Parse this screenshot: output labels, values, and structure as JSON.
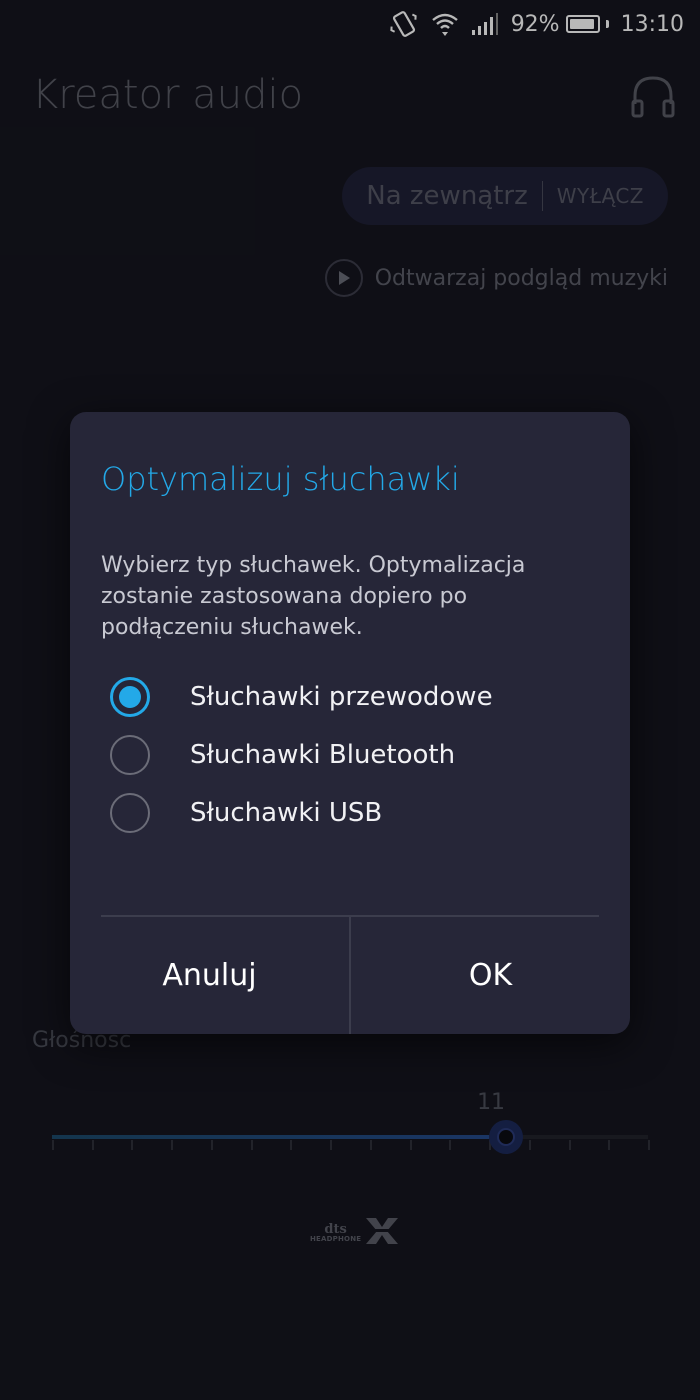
{
  "status_bar": {
    "battery_percent": "92%",
    "battery_level": 0.92,
    "time": "13:10"
  },
  "app": {
    "title": "Kreator audio",
    "mode_pill": {
      "label": "Na zewnątrz",
      "off_label": "WYŁĄCZ"
    },
    "preview_label": "Odtwarzaj podgląd muzyki",
    "volume": {
      "label": "Głośnosc",
      "value": "11",
      "value_num": 11,
      "max": 15
    },
    "logo": {
      "brand": "dts",
      "sub": "HEADPHONE",
      "mark": "X"
    }
  },
  "dialog": {
    "title": "Optymalizuj słuchawki",
    "message": "Wybierz typ słuchawek. Optymalizacja zostanie zastosowana dopiero po podłączeniu słuchawek.",
    "options": [
      {
        "label": "Słuchawki przewodowe",
        "selected": true
      },
      {
        "label": "Słuchawki Bluetooth",
        "selected": false
      },
      {
        "label": "Słuchawki USB",
        "selected": false
      }
    ],
    "cancel_label": "Anuluj",
    "ok_label": "OK"
  },
  "colors": {
    "accent": "#23a9e8",
    "dialog_bg": "#262638",
    "screen_bg": "#15161f"
  }
}
